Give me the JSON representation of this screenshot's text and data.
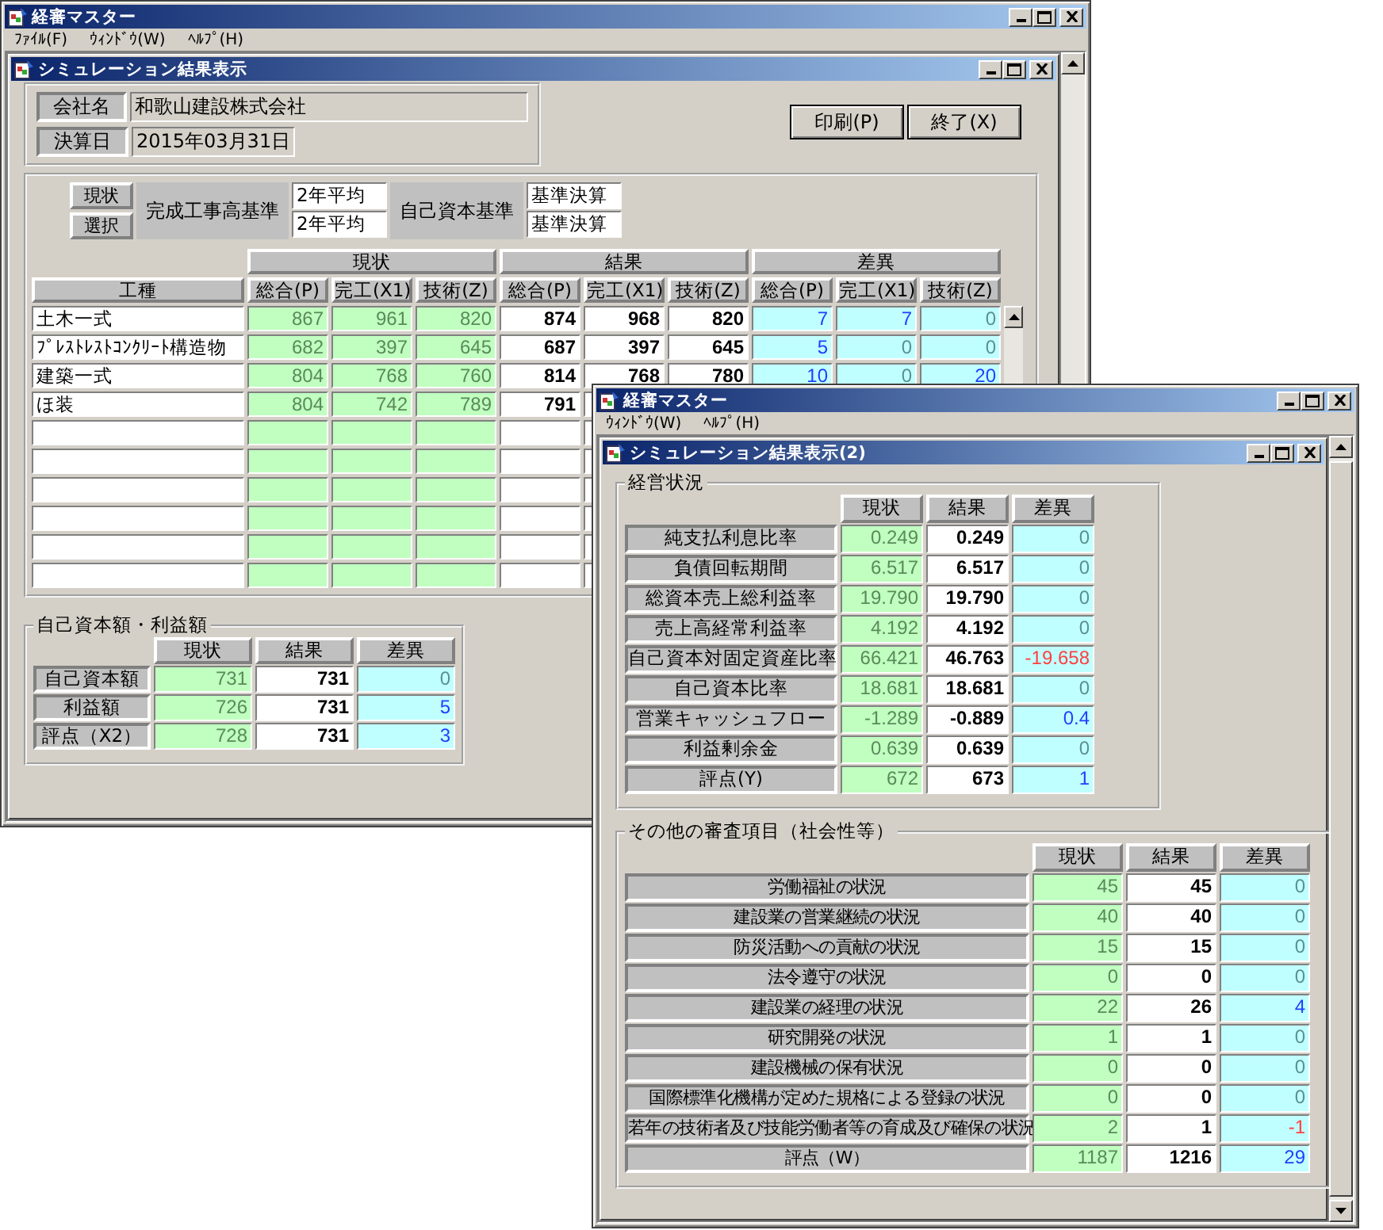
{
  "back_window": {
    "title": "経審マスター",
    "menu": [
      "ﾌｧｲﾙ(F)",
      "ｳｨﾝﾄﾞｳ(W)",
      "ﾍﾙﾌﾟ(H)"
    ],
    "child": {
      "title": "シミュレーション結果表示",
      "company": {
        "label": "会社名",
        "value": "和歌山建設株式会社"
      },
      "closing_date": {
        "label": "決算日",
        "value": "2015年03月31日"
      },
      "buttons": [
        "印刷(P)",
        "終了(X)"
      ],
      "selection": {
        "row_labels": [
          "現状",
          "選択"
        ],
        "sales_basis": {
          "label": "完成工事高基準",
          "values": [
            "2年平均",
            "2年平均"
          ]
        },
        "equity_basis": {
          "label": "自己資本基準",
          "values": [
            "基準決算",
            "基準決算"
          ]
        }
      },
      "table": {
        "name_header": "工種",
        "groups": [
          {
            "label": "現状",
            "subcolumns": [
              "総合(P)",
              "完工(X1)",
              "技術(Z)"
            ]
          },
          {
            "label": "結果",
            "subcolumns": [
              "総合(P)",
              "完工(X1)",
              "技術(Z)"
            ]
          },
          {
            "label": "差異",
            "subcolumns": [
              "総合(P)",
              "完工(X1)",
              "技術(Z)"
            ]
          }
        ],
        "rows": [
          {
            "name": "土木一式",
            "current": [
              "867",
              "961",
              "820"
            ],
            "result": [
              "874",
              "968",
              "820"
            ],
            "diff": [
              "7",
              "7",
              "0"
            ]
          },
          {
            "name": "ﾌﾟﾚｽﾄﾚｽﾄｺﾝｸﾘｰﾄ構造物",
            "current": [
              "682",
              "397",
              "645"
            ],
            "result": [
              "687",
              "397",
              "645"
            ],
            "diff": [
              "5",
              "0",
              "0"
            ]
          },
          {
            "name": "建築一式",
            "current": [
              "804",
              "768",
              "760"
            ],
            "result": [
              "814",
              "768",
              "780"
            ],
            "diff": [
              "10",
              "0",
              "20"
            ]
          },
          {
            "name": "ほ装",
            "current": [
              "804",
              "742",
              "789"
            ],
            "result": [
              "791"
            ]
          }
        ]
      },
      "equity_profit": {
        "title": "自己資本額・利益額",
        "columns": [
          "現状",
          "結果",
          "差異"
        ],
        "rows": [
          {
            "label": "自己資本額",
            "current": "731",
            "result": "731",
            "diff": "0"
          },
          {
            "label": "利益額",
            "current": "726",
            "result": "731",
            "diff": "5"
          },
          {
            "label": "評点（X2）",
            "current": "728",
            "result": "731",
            "diff": "3"
          }
        ]
      }
    }
  },
  "front_window": {
    "title": "経審マスター",
    "menu": [
      "ｳｨﾝﾄﾞｳ(W)",
      "ﾍﾙﾌﾟ(H)"
    ],
    "child": {
      "title": "シミュレーション結果表示(2)",
      "management": {
        "title": "経営状況",
        "columns": [
          "現状",
          "結果",
          "差異"
        ],
        "rows": [
          {
            "label": "純支払利息比率",
            "current": "0.249",
            "result": "0.249",
            "diff": "0"
          },
          {
            "label": "負債回転期間",
            "current": "6.517",
            "result": "6.517",
            "diff": "0"
          },
          {
            "label": "総資本売上総利益率",
            "current": "19.790",
            "result": "19.790",
            "diff": "0"
          },
          {
            "label": "売上高経常利益率",
            "current": "4.192",
            "result": "4.192",
            "diff": "0"
          },
          {
            "label": "自己資本対固定資産比率",
            "current": "66.421",
            "result": "46.763",
            "diff": "-19.658"
          },
          {
            "label": "自己資本比率",
            "current": "18.681",
            "result": "18.681",
            "diff": "0"
          },
          {
            "label": "営業キャッシュフロー",
            "current": "-1.289",
            "result": "-0.889",
            "diff": "0.4"
          },
          {
            "label": "利益剰余金",
            "current": "0.639",
            "result": "0.639",
            "diff": "0"
          },
          {
            "label": "評点(Y)",
            "current": "672",
            "result": "673",
            "diff": "1"
          }
        ]
      },
      "social": {
        "title": "その他の審査項目（社会性等）",
        "columns": [
          "現状",
          "結果",
          "差異"
        ],
        "rows": [
          {
            "label": "労働福祉の状況",
            "current": "45",
            "result": "45",
            "diff": "0"
          },
          {
            "label": "建設業の営業継続の状況",
            "current": "40",
            "result": "40",
            "diff": "0"
          },
          {
            "label": "防災活動への貢献の状況",
            "current": "15",
            "result": "15",
            "diff": "0"
          },
          {
            "label": "法令遵守の状況",
            "current": "0",
            "result": "0",
            "diff": "0"
          },
          {
            "label": "建設業の経理の状況",
            "current": "22",
            "result": "26",
            "diff": "4"
          },
          {
            "label": "研究開発の状況",
            "current": "1",
            "result": "1",
            "diff": "0"
          },
          {
            "label": "建設機械の保有状況",
            "current": "0",
            "result": "0",
            "diff": "0"
          },
          {
            "label": "国際標準化機構が定めた規格による登録の状況",
            "current": "0",
            "result": "0",
            "diff": "0"
          },
          {
            "label": "若年の技術者及び技能労働者等の育成及び確保の状況",
            "current": "2",
            "result": "1",
            "diff": "-1"
          },
          {
            "label": "評点（W）",
            "current": "1187",
            "result": "1216",
            "diff": "29"
          }
        ]
      }
    }
  }
}
